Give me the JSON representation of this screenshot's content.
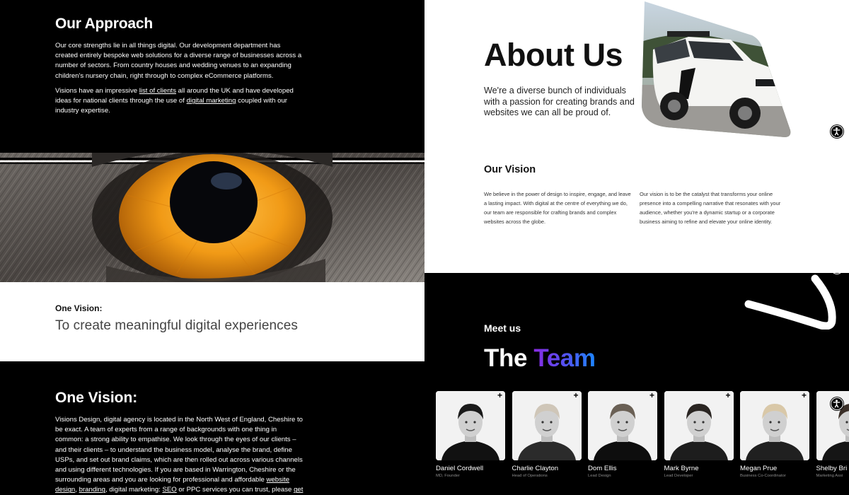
{
  "approach": {
    "title": "Our Approach",
    "p1": "Our core strengths lie in all things digital. Our development department has created entirely bespoke web solutions for a diverse range of businesses across a number of sectors. From country houses and wedding venues to an expanding children's nursery chain, right through to complex eCommerce platforms.",
    "p2_before": "Visions have an impressive ",
    "p2_link1": "list of clients",
    "p2_mid": " all around the UK and have developed ideas for national clients through the use of ",
    "p2_link2": "digital marketing",
    "p2_after": " coupled with our industry expertise."
  },
  "vision_quote": {
    "label": "One Vision:",
    "quote": "To create meaningful digital experiences"
  },
  "one_vision": {
    "title": "One Vision:",
    "text": "Visions Design, digital agency is located in the North West of England, Cheshire to be exact. A team of experts from a range of backgrounds with one thing in common: a strong ability to empathise. We look through the eyes of our clients – and their clients – to understand the business model, analyse the brand, define USPs, and set out brand claims, which are then rolled out across various channels and using different technologies. If you are based in Warrington, Cheshire or the surrounding areas and you are looking for professional and affordable ",
    "link_website_design": "website design",
    "sep1": ", ",
    "link_branding": "branding",
    "sep2": ", digital marketing: ",
    "link_seo": "SEO",
    "sep3": " or PPC services you can trust, please ",
    "link_get": "get"
  },
  "about": {
    "title": "About Us",
    "intro": "We're a diverse bunch of individuals with a passion for creating brands and websites we can all be proud of.",
    "vision_title": "Our Vision",
    "vision_col1": "We believe in the power of design to inspire, engage, and leave a lasting impact. With digital at the centre of everything we do, our team are responsible for crafting brands and complex websites across the globe.",
    "vision_col2": "Our vision is to be the catalyst that transforms your online presence into a compelling narrative that resonates with your audience, whether you're a dynamic startup or a corporate business aiming to refine and elevate your online identity."
  },
  "team": {
    "meet": "Meet us",
    "title_plain": "The ",
    "title_accent": "Team",
    "plus_symbol": "+",
    "members": [
      {
        "name": "Daniel Cordwell",
        "role": "MD, Founder"
      },
      {
        "name": "Charlie Clayton",
        "role": "Head of Operations"
      },
      {
        "name": "Dom Ellis",
        "role": "Lead Design"
      },
      {
        "name": "Mark Byrne",
        "role": "Lead Developer"
      },
      {
        "name": "Megan Prue",
        "role": "Business Co-Coordinator"
      },
      {
        "name": "Shelby Bri",
        "role": "Marketing Assi"
      }
    ]
  },
  "icons": {
    "accessibility": "accessibility-icon",
    "swoosh": "swoosh-decoration"
  },
  "colors": {
    "gradient_start": "#8a2be2",
    "gradient_end": "#1c86ff",
    "eye_orange": "#f0a020"
  }
}
